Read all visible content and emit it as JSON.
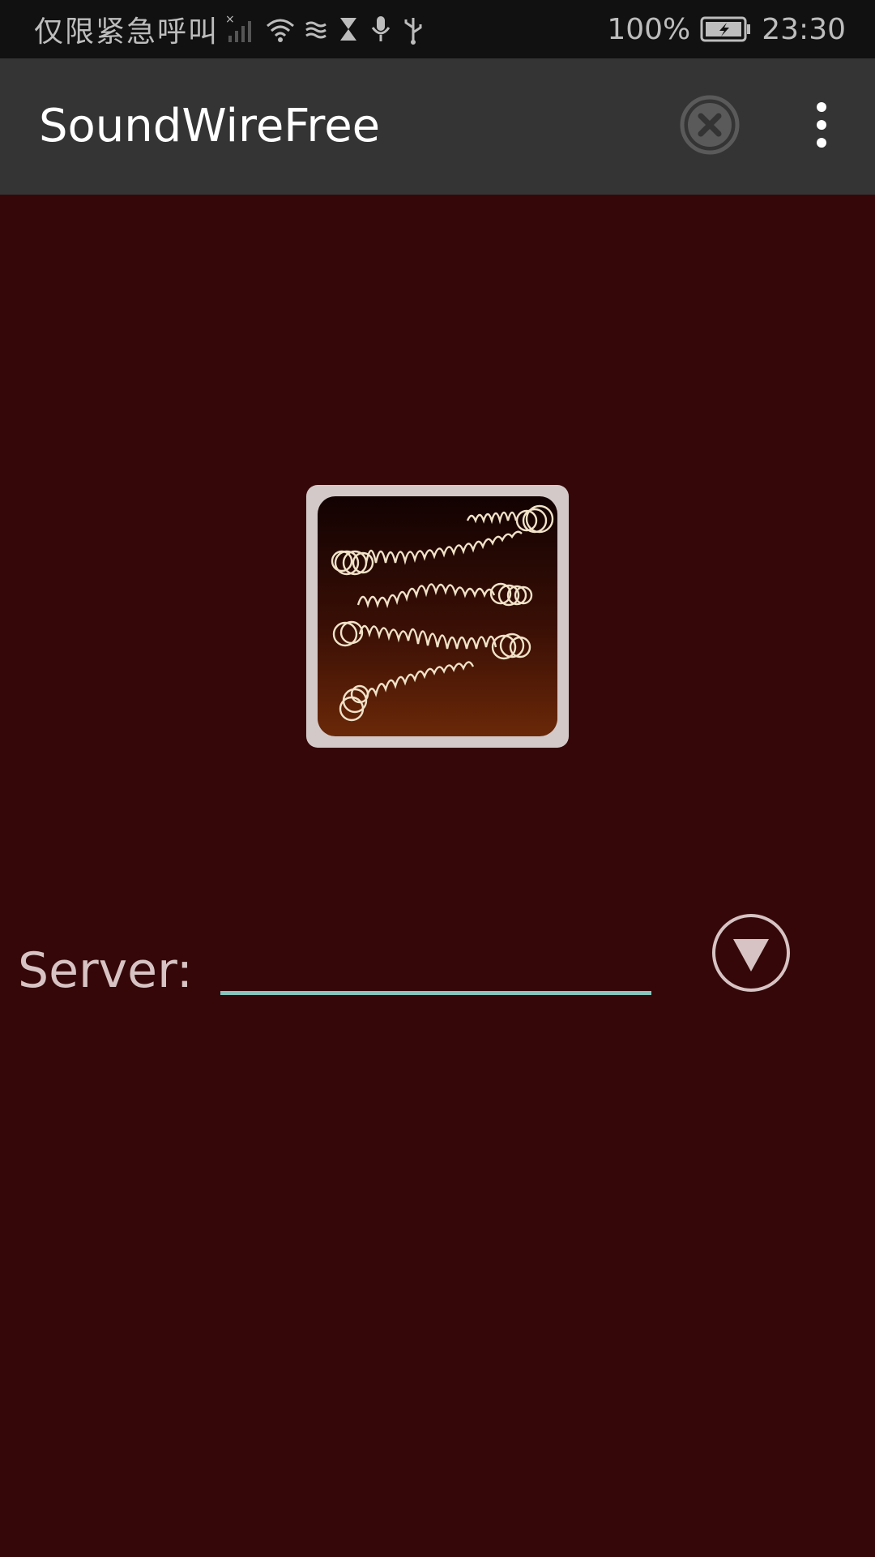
{
  "status_bar": {
    "carrier": "仅限紧急呼叫",
    "battery": "100%",
    "time": "23:30",
    "icons": [
      "signal-icon",
      "wifi-icon",
      "data-icon",
      "hourglass-icon",
      "mic-icon",
      "usb-icon",
      "battery-icon"
    ]
  },
  "app_bar": {
    "title": "SoundWireFree",
    "close_icon": "close-circle-icon",
    "menu_icon": "more-vert-icon"
  },
  "main": {
    "logo": "soundwire-logo",
    "server_label": "Server:",
    "server_value": "",
    "dropdown_icon": "dropdown-triangle-icon"
  },
  "colors": {
    "background": "#350709",
    "app_bar": "#343434",
    "status_bar": "#111111",
    "accent_underline": "#86c4bd",
    "label": "#d7c3c3"
  }
}
